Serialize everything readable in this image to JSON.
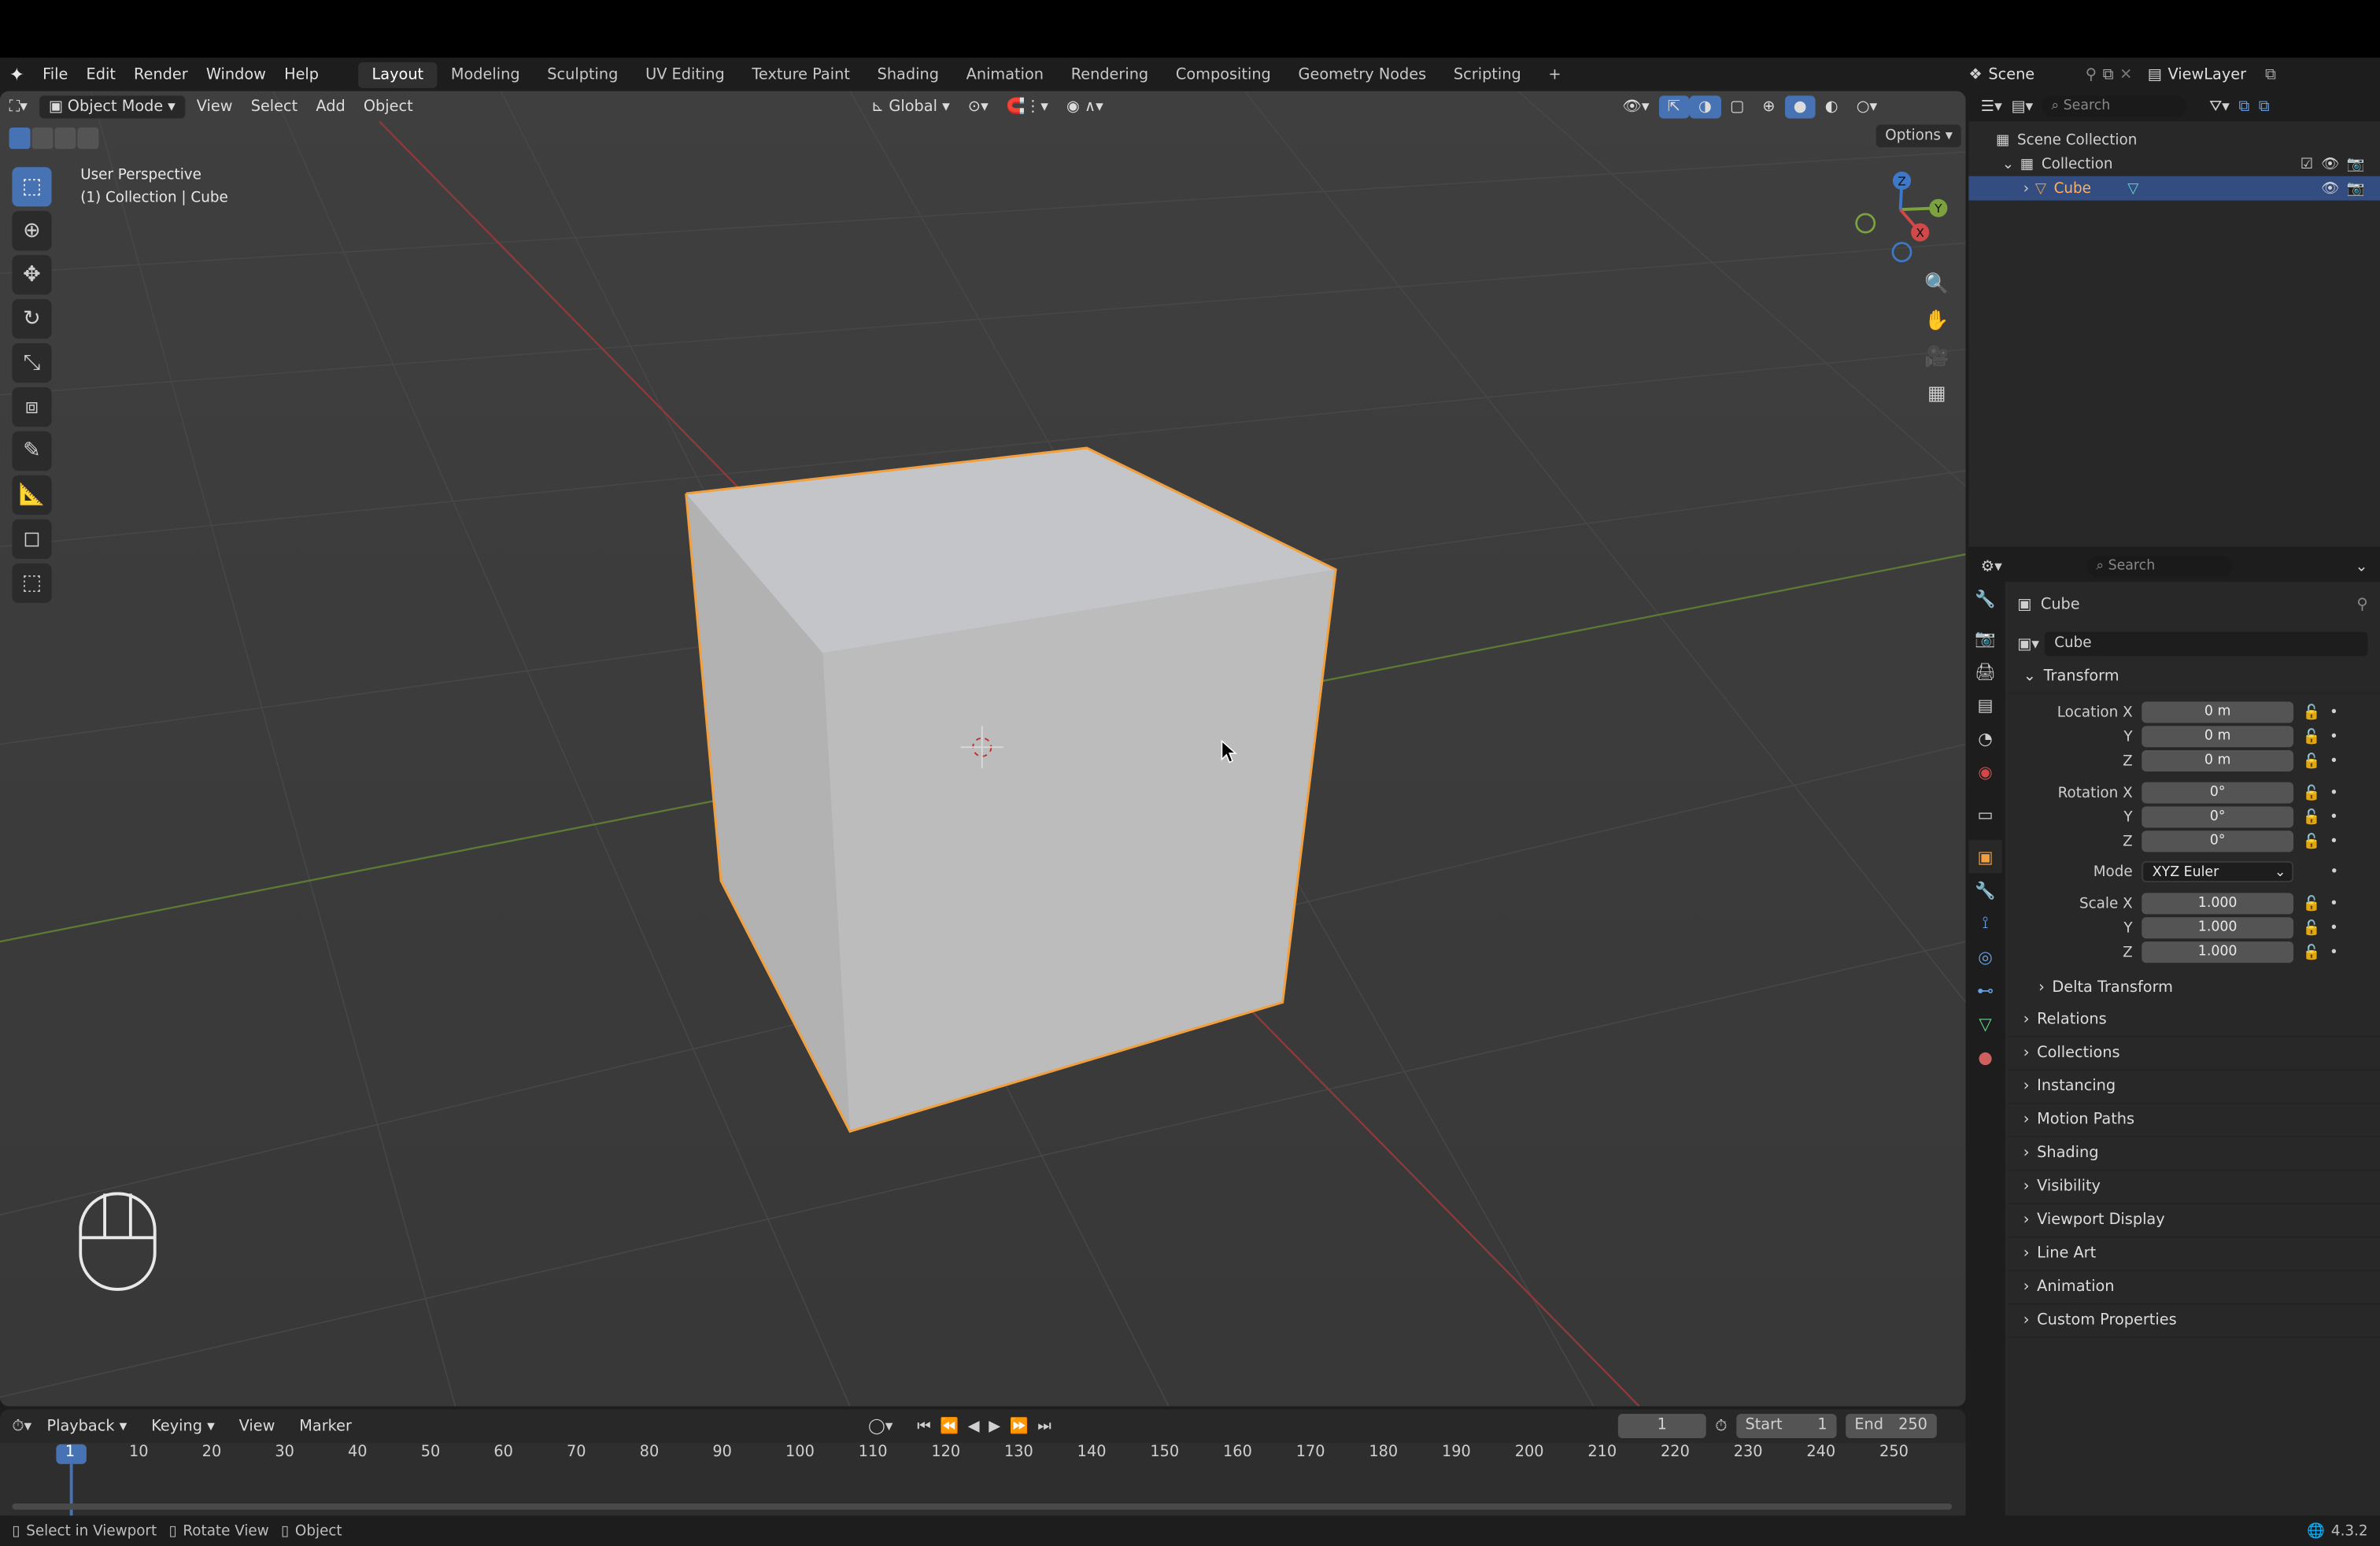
{
  "menu": {
    "items": [
      "File",
      "Edit",
      "Render",
      "Window",
      "Help"
    ]
  },
  "workspaces": [
    "Layout",
    "Modeling",
    "Sculpting",
    "UV Editing",
    "Texture Paint",
    "Shading",
    "Animation",
    "Rendering",
    "Compositing",
    "Geometry Nodes",
    "Scripting"
  ],
  "scene": {
    "name": "Scene",
    "view_layer": "ViewLayer"
  },
  "viewport": {
    "mode": "Object Mode",
    "menus": [
      "View",
      "Select",
      "Add",
      "Object"
    ],
    "transform_orientation": "Global",
    "info_line1": "User Perspective",
    "info_line2": "(1) Collection | Cube",
    "options_label": "Options"
  },
  "gizmo": {
    "x": "X",
    "y": "Y",
    "z": "Z"
  },
  "outliner": {
    "search_placeholder": "Search",
    "scene_collection": "Scene Collection",
    "collection": "Collection",
    "object": "Cube"
  },
  "properties": {
    "search_placeholder": "Search",
    "object_name": "Cube",
    "data_name": "Cube",
    "transform": {
      "title": "Transform",
      "location": {
        "label": "Location X",
        "x": "0 m",
        "y": "0 m",
        "z": "0 m"
      },
      "rotation": {
        "label": "Rotation X",
        "x": "0°",
        "y": "0°",
        "z": "0°"
      },
      "mode_label": "Mode",
      "mode_value": "XYZ Euler",
      "scale": {
        "label": "Scale X",
        "x": "1.000",
        "y": "1.000",
        "z": "1.000"
      },
      "y_label": "Y",
      "z_label": "Z"
    },
    "delta_transform": "Delta Transform",
    "panels": [
      "Relations",
      "Collections",
      "Instancing",
      "Motion Paths",
      "Shading",
      "Visibility",
      "Viewport Display",
      "Line Art",
      "Animation",
      "Custom Properties"
    ]
  },
  "timeline": {
    "menus": [
      "Playback",
      "Keying",
      "View",
      "Marker"
    ],
    "current_frame": "1",
    "start_label": "Start",
    "start": "1",
    "end_label": "End",
    "end": "250",
    "ticks": [
      "1",
      "10",
      "20",
      "30",
      "40",
      "50",
      "60",
      "70",
      "80",
      "90",
      "100",
      "110",
      "120",
      "130",
      "140",
      "150",
      "160",
      "170",
      "180",
      "190",
      "200",
      "210",
      "220",
      "230",
      "240",
      "250"
    ]
  },
  "status": {
    "select": "Select in Viewport",
    "rotate": "Rotate View",
    "object": "Object",
    "version": "4.3.2"
  },
  "colors": {
    "accent": "#4772b3",
    "selection_outline": "#f0a040",
    "x_axis": "#d04848",
    "y_axis": "#7ba23f",
    "z_axis": "#3d78c9"
  }
}
